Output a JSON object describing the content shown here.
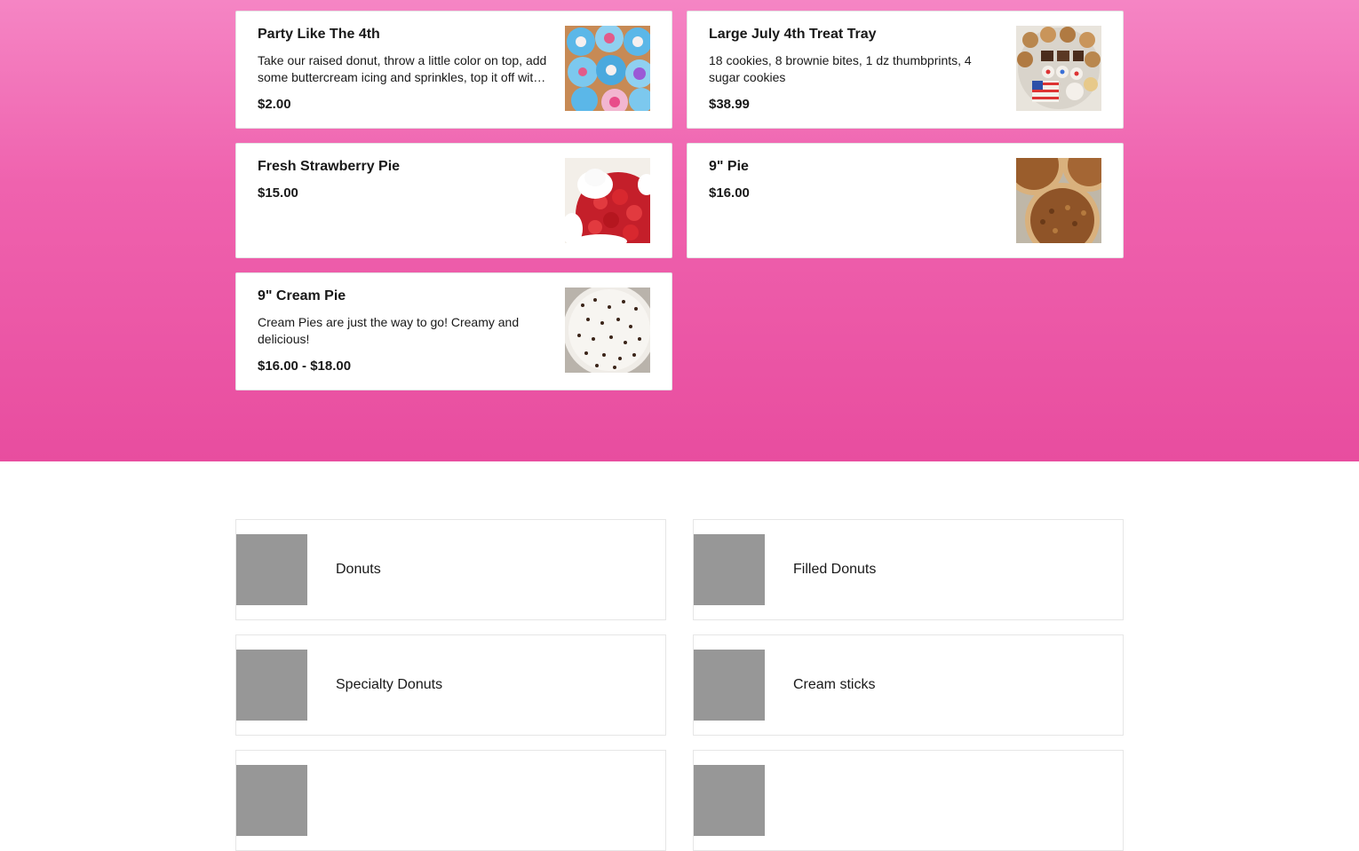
{
  "menu_items": [
    {
      "name": "Party Like The 4th",
      "description": "Take our raised donut, throw a little color on top, add some buttercream icing and sprinkles, top it off with a festive ring!",
      "price": "$2.00",
      "image_icon": "cupcake-donut-image"
    },
    {
      "name": "Large July 4th Treat Tray",
      "description": "18 cookies, 8 brownie bites, 1 dz thumbprints, 4 sugar cookies",
      "price": "$38.99",
      "image_icon": "treat-tray-image"
    },
    {
      "name": "Fresh Strawberry Pie",
      "description": "",
      "price": "$15.00",
      "image_icon": "strawberry-pie-image"
    },
    {
      "name": "9\" Pie",
      "description": "",
      "price": "$16.00",
      "image_icon": "pecan-pie-image"
    },
    {
      "name": "9\" Cream Pie",
      "description": "Cream Pies are just the way to go! Creamy and delicious!",
      "price": "$16.00 - $18.00",
      "image_icon": "cream-pie-image"
    }
  ],
  "categories": [
    {
      "label": "Donuts"
    },
    {
      "label": "Filled Donuts"
    },
    {
      "label": "Specialty Donuts"
    },
    {
      "label": "Cream sticks"
    },
    {
      "label": ""
    },
    {
      "label": ""
    }
  ],
  "colors": {
    "hero_top": "#f585c4",
    "hero_bottom": "#e84d9f",
    "placeholder": "#979797"
  }
}
